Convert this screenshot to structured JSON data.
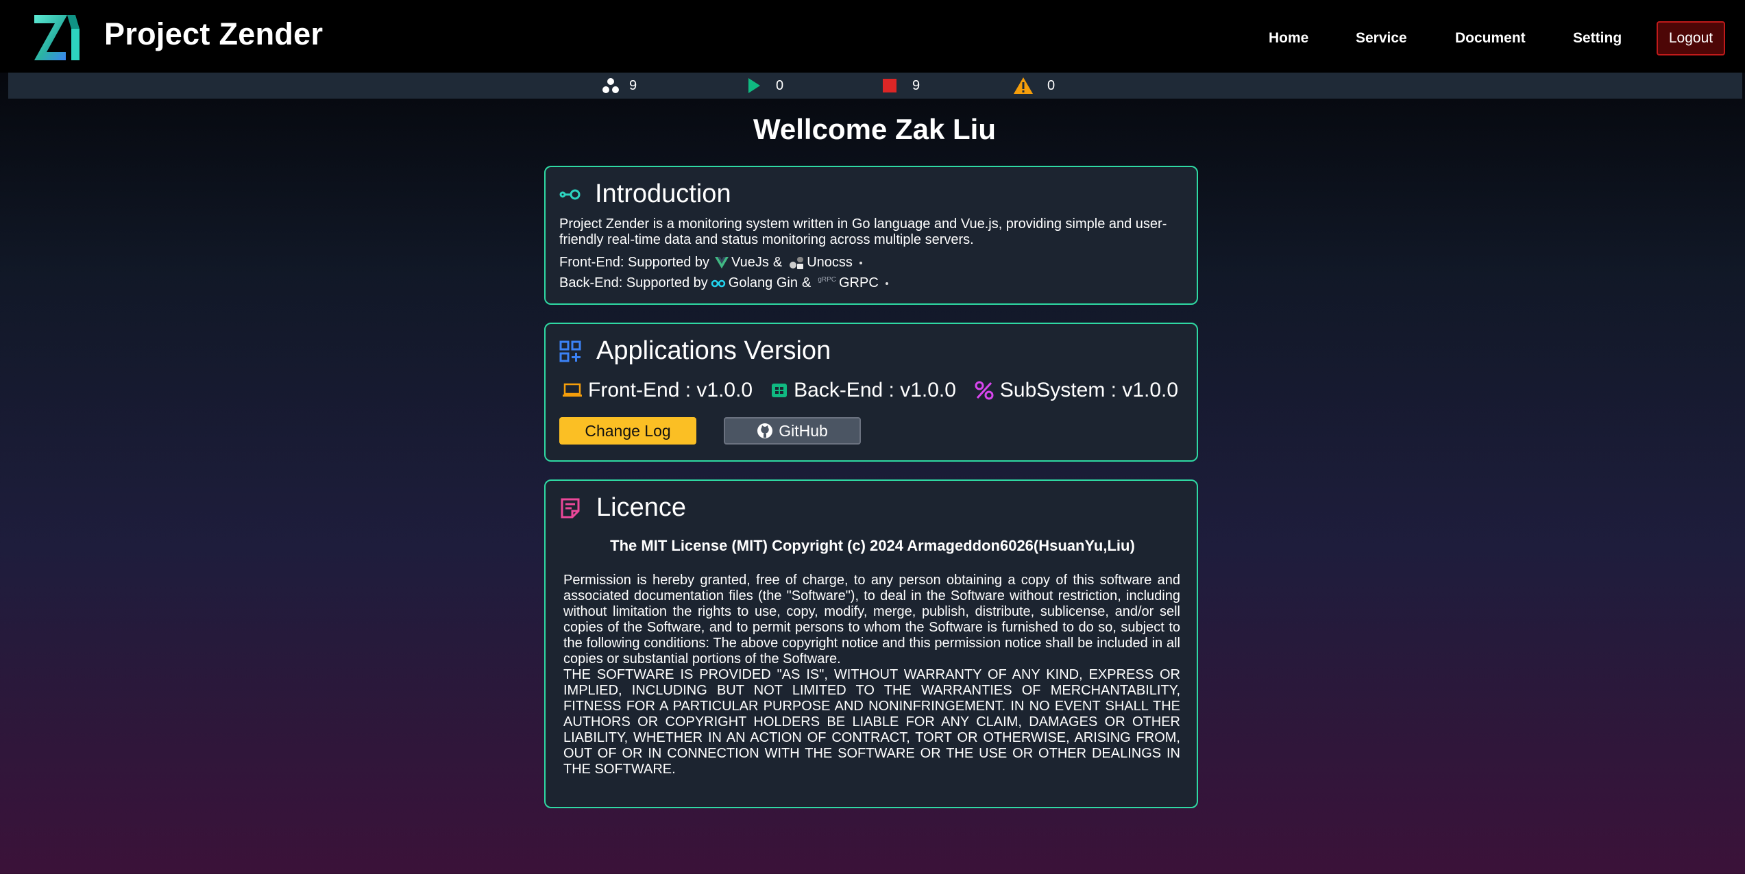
{
  "header": {
    "app_title": "Project Zender",
    "nav": {
      "home": "Home",
      "service": "Service",
      "document": "Document",
      "setting": "Setting",
      "logout": "Logout"
    }
  },
  "status": {
    "nodes": "9",
    "running": "0",
    "stopped": "9",
    "warnings": "0"
  },
  "welcome": "Wellcome Zak Liu",
  "introduction": {
    "title": "Introduction",
    "paragraph": "Project Zender is a monitoring system written in Go language and Vue.js, providing simple and user-friendly real-time data and status monitoring across multiple servers.",
    "frontend_prefix": "Front-End: Supported by",
    "frontend_tech1": "VueJs",
    "amp": "&",
    "frontend_tech2": "Unocss",
    "backend_prefix": "Back-End: Supported by",
    "backend_tech1": "Golang Gin",
    "backend_tech2": "GRPC",
    "grpc_logo_text": "gRPC"
  },
  "versions": {
    "title": "Applications Version",
    "frontend": "Front-End : v1.0.0",
    "backend": "Back-End : v1.0.0",
    "subsystem": "SubSystem : v1.0.0",
    "changelog_btn": "Change Log",
    "github_btn": "GitHub"
  },
  "licence": {
    "title": "Licence",
    "heading": "The MIT License (MIT) Copyright (c) 2024 Armageddon6026(HsuanYu,Liu)",
    "permission": "Permission is hereby granted, free of charge, to any person obtaining a copy of this software and associated documentation files (the \"Software\"), to deal in the Software without restriction, including without limitation the rights to use, copy, modify, merge, publish, distribute, sublicense, and/or sell copies of the Software, and to permit persons to whom the Software is furnished to do so, subject to the following conditions: The above copyright notice and this permission notice shall be included in all copies or substantial portions of the Software.",
    "warranty": "THE SOFTWARE IS PROVIDED \"AS IS\", WITHOUT WARRANTY OF ANY KIND, EXPRESS OR IMPLIED, INCLUDING BUT NOT LIMITED TO THE WARRANTIES OF MERCHANTABILITY, FITNESS FOR A PARTICULAR PURPOSE AND NONINFRINGEMENT. IN NO EVENT SHALL THE AUTHORS OR COPYRIGHT HOLDERS BE LIABLE FOR ANY CLAIM, DAMAGES OR OTHER LIABILITY, WHETHER IN AN ACTION OF CONTRACT, TORT OR OTHERWISE, ARISING FROM, OUT OF OR IN CONNECTION WITH THE SOFTWARE OR THE USE OR OTHER DEALINGS IN THE SOFTWARE."
  },
  "icons": {
    "logo": "zender-logo",
    "nodes": "cluster-icon",
    "running": "play-icon",
    "stopped": "stop-icon",
    "warnings": "warning-icon",
    "introduction": "link-icon",
    "versions": "apps-grid-icon",
    "licence": "document-icon",
    "frontend": "laptop-icon",
    "backend": "server-icon",
    "subsystem": "percent-icon",
    "github": "github-icon"
  },
  "colors": {
    "accent_border": "#2fd9a3",
    "card_bg": "#1c2430",
    "status_bar": "#1f2a37",
    "play": "#10b981",
    "stop": "#dc2626",
    "warning": "#f59e0b",
    "changelog_btn": "#fbbf24",
    "logout_bg": "#4d0606",
    "logout_border": "#c01a1a"
  }
}
